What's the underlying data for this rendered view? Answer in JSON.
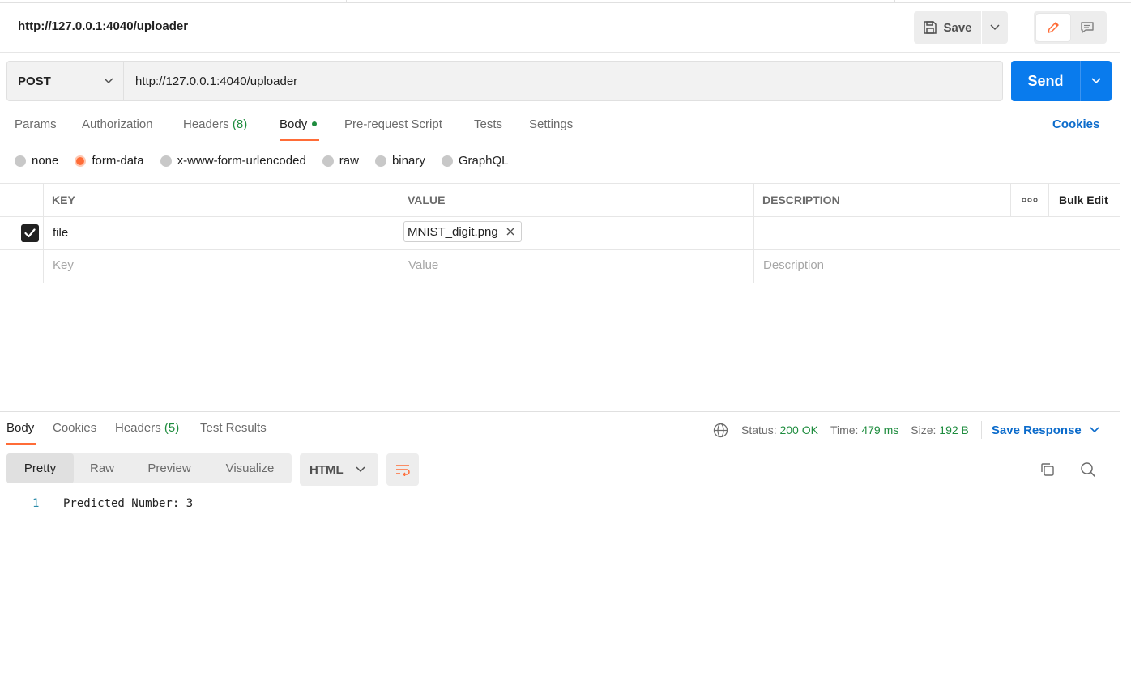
{
  "request": {
    "title": "http://127.0.0.1:4040/uploader",
    "save_label": "Save",
    "method": "POST",
    "url": "http://127.0.0.1:4040/uploader",
    "send_label": "Send"
  },
  "request_tabs": {
    "params": "Params",
    "authorization": "Authorization",
    "headers": "Headers",
    "headers_count": "(8)",
    "body": "Body",
    "pre_request": "Pre-request Script",
    "tests": "Tests",
    "settings": "Settings",
    "cookies": "Cookies",
    "active": "Body"
  },
  "body_types": {
    "none": "none",
    "form_data": "form-data",
    "urlencoded": "x-www-form-urlencoded",
    "raw": "raw",
    "binary": "binary",
    "graphql": "GraphQL",
    "selected": "form-data"
  },
  "form_table": {
    "headers": {
      "key": "KEY",
      "value": "VALUE",
      "description": "DESCRIPTION",
      "bulk_edit": "Bulk Edit"
    },
    "rows": [
      {
        "checked": true,
        "key": "file",
        "value": "MNIST_digit.png",
        "description": ""
      }
    ],
    "placeholders": {
      "key": "Key",
      "value": "Value",
      "description": "Description"
    }
  },
  "response": {
    "tabs": {
      "body": "Body",
      "cookies": "Cookies",
      "headers": "Headers",
      "headers_count": "(5)",
      "test_results": "Test Results",
      "active": "Body"
    },
    "status_label": "Status:",
    "status_value": "200 OK",
    "time_label": "Time:",
    "time_value": "479 ms",
    "size_label": "Size:",
    "size_value": "192 B",
    "save_response": "Save Response",
    "views": {
      "pretty": "Pretty",
      "raw": "Raw",
      "preview": "Preview",
      "visualize": "Visualize",
      "active": "Pretty"
    },
    "format": "HTML",
    "lines": [
      {
        "no": "1",
        "text": "Predicted Number: 3"
      }
    ]
  },
  "colors": {
    "accent_orange": "#ff6c37",
    "send_blue": "#097bed",
    "link_blue": "#0b6bcb",
    "success_green": "#1e8c3e"
  },
  "icons": [
    "save-icon",
    "chevron-down-icon",
    "pencil-icon",
    "comment-icon",
    "checkbox-checked-icon",
    "close-icon",
    "more-horizontal-icon",
    "globe-icon",
    "wrap-lines-icon",
    "copy-icon",
    "search-icon"
  ]
}
